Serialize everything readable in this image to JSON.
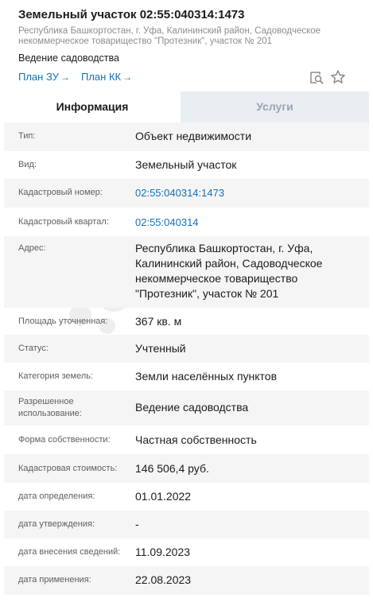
{
  "header": {
    "title": "Земельный участок 02:55:040314:1473",
    "address_line1": "Республика Башкортостан, г. Уфа, Калининский район, Садоводческое",
    "address_line2": "некоммерческое товарищество \"Протезник\", участок № 201",
    "purpose": "Ведение садоводства",
    "plan_zu": "План ЗУ",
    "plan_kk": "План КК",
    "arrow": "→"
  },
  "tabs": {
    "info": "Информация",
    "services": "Услуги"
  },
  "rows": [
    {
      "label": "Тип:",
      "value": "Объект недвижимости"
    },
    {
      "label": "Вид:",
      "value": "Земельный участок"
    },
    {
      "label": "Кадастровый номер:",
      "value": "02:55:040314:1473"
    },
    {
      "label": "Кадастровый квартал:",
      "value": "02:55:040314"
    },
    {
      "label": "Адрес:",
      "value": "Республика Башкортостан, г. Уфа, Калининский район, Садоводческое некоммерческое товарищество \"Протезник\", участок № 201"
    },
    {
      "label": "Площадь уточненная:",
      "value": "367 кв. м"
    },
    {
      "label": "Статус:",
      "value": "Учтенный"
    },
    {
      "label": "Категория земель:",
      "value": "Земли населённых пунктов"
    },
    {
      "label": "Разрешенное использование:",
      "value": "Ведение садоводства"
    },
    {
      "label": "Форма собственности:",
      "value": "Частная собственность"
    },
    {
      "label": "Кадастровая стоимость:",
      "value": "146 506,4 руб."
    },
    {
      "label": "дата определения:",
      "value": "01.01.2022"
    },
    {
      "label": "дата утверждения:",
      "value": "-"
    },
    {
      "label": "дата внесения сведений:",
      "value": "11.09.2023"
    },
    {
      "label": "дата применения:",
      "value": "22.08.2023"
    }
  ],
  "icons": {
    "map_search": "map-search-icon",
    "favorite": "star-icon"
  },
  "colors": {
    "link": "#1570b8",
    "tab_inactive_bg": "#e9eef2",
    "row_alt_bg": "#f5f5f5"
  }
}
